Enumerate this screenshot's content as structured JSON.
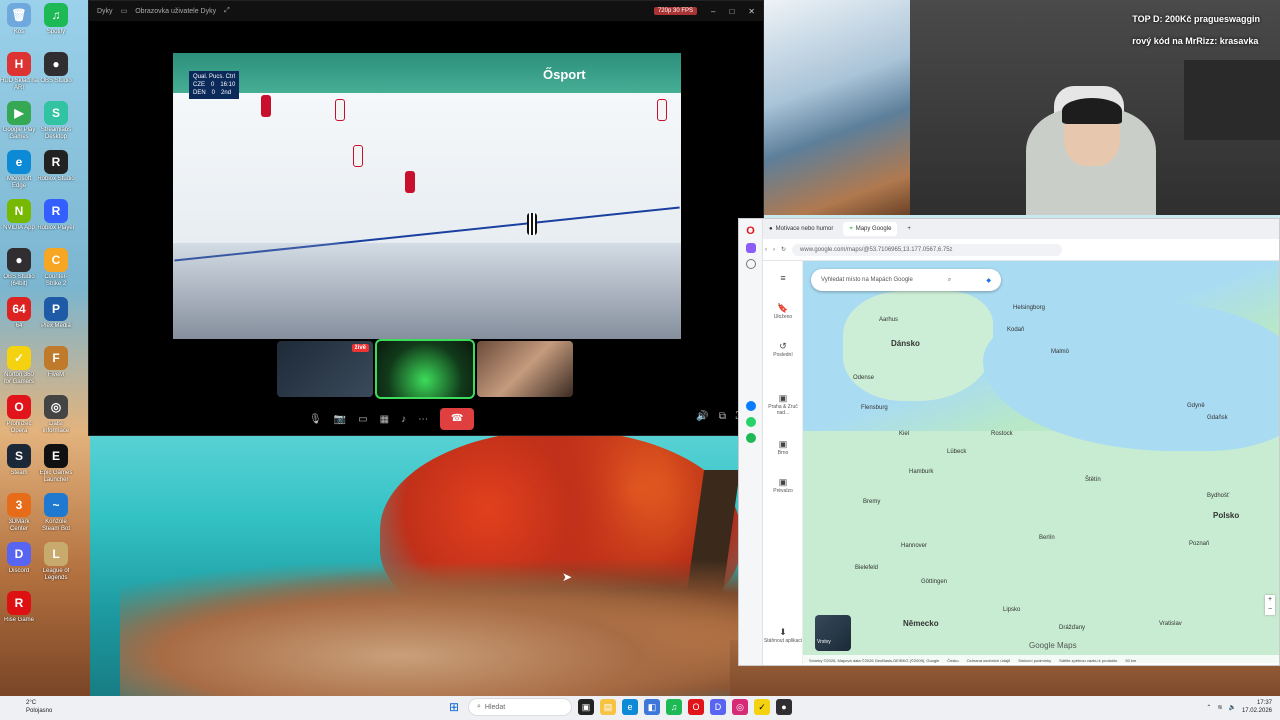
{
  "desktop": {
    "icons": [
      {
        "label": "Koš",
        "glyph": "🗑",
        "color": "#6fa8dc"
      },
      {
        "label": "Spotify",
        "glyph": "♫",
        "color": "#1db954"
      },
      {
        "label": "HUD Sklad na ARI",
        "glyph": "H",
        "color": "#d33"
      },
      {
        "label": "OBS Studio",
        "glyph": "●",
        "color": "#302e31"
      },
      {
        "label": "Google Play Games",
        "glyph": "▶",
        "color": "#34a853"
      },
      {
        "label": "Streamlabs Desktop",
        "glyph": "S",
        "color": "#31c3a2"
      },
      {
        "label": "Microsoft Edge",
        "glyph": "e",
        "color": "#0c8ad6"
      },
      {
        "label": "Roblox Studio",
        "glyph": "R",
        "color": "#222"
      },
      {
        "label": "NVIDIA App",
        "glyph": "N",
        "color": "#76b900"
      },
      {
        "label": "Roblox Player",
        "glyph": "R",
        "color": "#335fff"
      },
      {
        "label": "OBS Studio (64bit)",
        "glyph": "●",
        "color": "#302e31"
      },
      {
        "label": "Counter-Strike 2",
        "glyph": "C",
        "color": "#f6a623"
      },
      {
        "label": "64",
        "glyph": "64",
        "color": "#d22"
      },
      {
        "label": "Plex Media",
        "glyph": "P",
        "color": "#1f5aa6"
      },
      {
        "label": "Norton 360 for Gamers",
        "glyph": "✓",
        "color": "#f5d20f"
      },
      {
        "label": "FiveM",
        "glyph": "F",
        "color": "#c07a2c"
      },
      {
        "label": "Prohlížeč Opera",
        "glyph": "O",
        "color": "#e2141b"
      },
      {
        "label": "Další informace",
        "glyph": "◎",
        "color": "#444"
      },
      {
        "label": "Steam",
        "glyph": "S",
        "color": "#1b2838"
      },
      {
        "label": "Epic Games Launcher",
        "glyph": "E",
        "color": "#111"
      },
      {
        "label": "3DMark Center",
        "glyph": "3",
        "color": "#e66c1a"
      },
      {
        "label": "Konzole Steam Bot",
        "glyph": "~",
        "color": "#1f79d1"
      },
      {
        "label": "Discord",
        "glyph": "D",
        "color": "#5865f2"
      },
      {
        "label": "League of Legends",
        "glyph": "L",
        "color": "#c8aa6e"
      },
      {
        "label": "Rise Game",
        "glyph": "R",
        "color": "#d11"
      }
    ]
  },
  "discord": {
    "app_name": "Dyky",
    "window_title": "Obrazovka uživatele Dyky",
    "quality_badge": "720p 30 FPS",
    "live_badge": "ŽIVĚ",
    "stream": {
      "score": {
        "header": "Qual. Pucs. Ctrl",
        "team1": "CZE",
        "score1": "0",
        "team2": "DEN",
        "score2": "0",
        "clock": "16:10",
        "period": "2nd"
      },
      "broadcaster": "Ősport"
    },
    "participant_live": "živě"
  },
  "webcam": {
    "donation_line1": "TOP D: 200Kč pragueswaggin",
    "donation_line2": "rový kód na MrRizz: krasavka"
  },
  "browser": {
    "tabs": [
      {
        "label": "Motivace nebo humor"
      },
      {
        "label": "Mapy Google"
      }
    ],
    "new_tab": "+",
    "url": "www.google.com/maps/@53.7106965,13.177.0567,6.75z",
    "maps": {
      "search_placeholder": "Vyhledat místo na Mapách Google",
      "nav": [
        {
          "label": "Uloženo",
          "icon": "bookmark-icon",
          "glyph": "🔖"
        },
        {
          "label": "Poslední",
          "icon": "history-icon",
          "glyph": "↺"
        },
        {
          "label": "Praha & Zruč nad...",
          "icon": "place-icon",
          "glyph": "▣"
        },
        {
          "label": "Brno",
          "icon": "place-icon",
          "glyph": "▣"
        },
        {
          "label": "Prévalzo",
          "icon": "place-icon",
          "glyph": "▣"
        },
        {
          "label": "Stáhnout aplikaci",
          "icon": "download-icon",
          "glyph": "⬇"
        }
      ],
      "labels": {
        "denmark": "Dánsko",
        "germany": "Německo",
        "poland": "Polsko",
        "copenhagen": "Kodaň",
        "helsingborg": "Helsingborg",
        "malmo": "Malmö",
        "hamburg": "Hamburk",
        "bremen": "Bremy",
        "hannover": "Hannover",
        "berlin": "Berlín",
        "stettin": "Štětín",
        "bielefeld": "Bielefeld",
        "dortmund": "Dortmund",
        "leipzig": "Lipsko",
        "dresden": "Drážďany",
        "wroclaw": "Vratislav",
        "poznan": "Poznaň",
        "bydgoszcz": "Bydhošť",
        "gdynia": "Gdyně",
        "gdansk": "Gdaňsk",
        "odense": "Odense",
        "aarhus": "Aarhus",
        "flensburg": "Flensburg",
        "luebeck": "Lübeck",
        "rostock": "Rostock",
        "kiel": "Kiel",
        "goettingen": "Göttingen"
      },
      "layers_label": "Vrstvy",
      "logo": "Google Maps",
      "footer": [
        "Snímky ©2026, Mapová data ©2026 GeoBasis-DE/BKG (©2009), Google",
        "Česko",
        "Ochrana osobních údajů",
        "Smluvní podmínky",
        "Sdělte zpětnou vazbu k produktu",
        "50 km"
      ]
    }
  },
  "taskbar": {
    "weather_line1": "2°C",
    "weather_line2": "Polojasno",
    "search_placeholder": "Hledat",
    "time": "17:37",
    "date": "17.02.2026"
  },
  "colors": {
    "accent": "#e03f3f",
    "opera": "#e2141b",
    "maps_water": "#a9dcf2",
    "maps_land": "#c7ecd1"
  }
}
